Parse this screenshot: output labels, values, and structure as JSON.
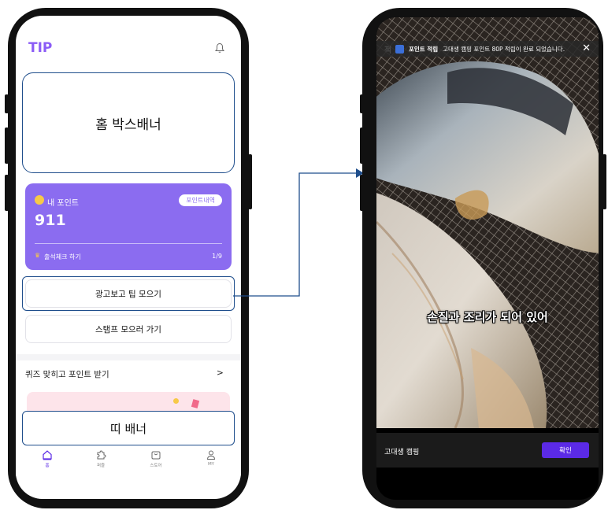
{
  "left_screen": {
    "logo": "TIP",
    "home_box_banner": "홈 박스배너",
    "point_card": {
      "label": "내 포인트",
      "history_button": "포인트내역",
      "value": "911",
      "attendance": "출석체크 하기",
      "progress": "1/9"
    },
    "ad_button": "광고보고 팁 모으기",
    "stamp_button": "스탬프 모으러 가기",
    "quiz_title": "퀴즈 맞히고 포인트 받기",
    "quiz_arrow": ">",
    "strip_banner": "띠 배너",
    "tabs": [
      {
        "label": "홈",
        "icon": "home-icon"
      },
      {
        "label": "퍼즐",
        "icon": "puzzle-icon"
      },
      {
        "label": "스토어",
        "icon": "store-icon"
      },
      {
        "label": "MY",
        "icon": "user-icon"
      }
    ]
  },
  "right_screen": {
    "toast": {
      "prefix": "적",
      "title": "포인트 적립",
      "message": "고대생 캠핑 포인트 80P 적립이 완료 되었습니다.",
      "close": "✕"
    },
    "subtitle": "손질과 조리가 되어 있어",
    "channel_name": "고대생 캠핑",
    "confirm_button": "확인"
  },
  "colors": {
    "brand_purple": "#8b6cf0",
    "annotation_blue": "#1f4e8c",
    "confirm_purple": "#5b2ae6"
  }
}
